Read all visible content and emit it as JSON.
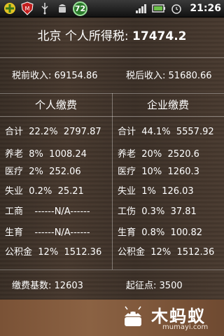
{
  "status_bar": {
    "time": "21:26",
    "battery_badge": "72",
    "icons": [
      "plus-icon",
      "mcafee-shield-icon",
      "usb-icon",
      "android-icon",
      "badge-72-icon",
      "signal-bars-icon",
      "battery-icon",
      "alarm-icon"
    ]
  },
  "header": {
    "city": "北京",
    "tax_label": "个人所得税:",
    "tax_value": "17474.2"
  },
  "income": {
    "pre_label": "税前收入:",
    "pre_value": "69154.86",
    "post_label": "税后收入:",
    "post_value": "51680.66"
  },
  "personal": {
    "title": "个人缴费",
    "rows": [
      {
        "name": "合计",
        "rate": "22.2%",
        "amount": "2797.87"
      },
      {
        "name": "养老",
        "rate": "8%",
        "amount": "1008.24"
      },
      {
        "name": "医疗",
        "rate": "2%",
        "amount": "252.06"
      },
      {
        "name": "失业",
        "rate": "0.2%",
        "amount": "25.21"
      },
      {
        "name": "工商",
        "rate": "------N/A------",
        "amount": ""
      },
      {
        "name": "生育",
        "rate": "------N/A------",
        "amount": ""
      },
      {
        "name": "公积金",
        "rate": "12%",
        "amount": "1512.36"
      }
    ]
  },
  "company": {
    "title": "企业缴费",
    "rows": [
      {
        "name": "合计",
        "rate": "44.1%",
        "amount": "5557.92"
      },
      {
        "name": "养老",
        "rate": "20%",
        "amount": "2520.6"
      },
      {
        "name": "医疗",
        "rate": "10%",
        "amount": "1260.3"
      },
      {
        "name": "失业",
        "rate": "1%",
        "amount": "126.03"
      },
      {
        "name": "工伤",
        "rate": "0.3%",
        "amount": "37.81"
      },
      {
        "name": "生育",
        "rate": "0.8%",
        "amount": "100.82"
      },
      {
        "name": "公积金",
        "rate": "12%",
        "amount": "1512.36"
      }
    ]
  },
  "footer": {
    "base_label": "缴费基数:",
    "base_value": "12603",
    "threshold_label": "起征点:",
    "threshold_value": "3500"
  },
  "watermark": {
    "brand": "木蚂蚁",
    "url": "mumayi.com"
  }
}
